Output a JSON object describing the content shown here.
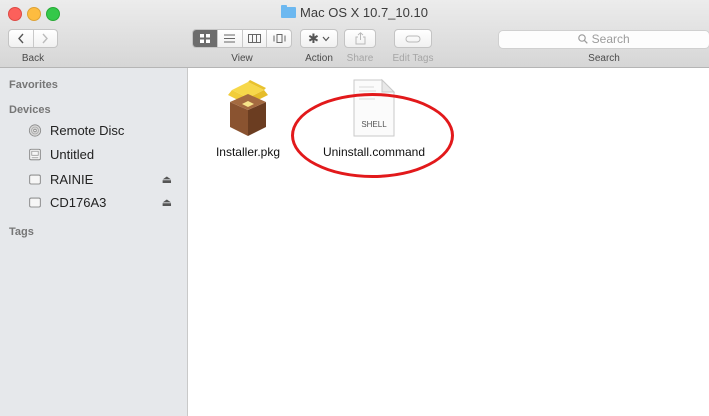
{
  "window": {
    "title": "Mac OS X 10.7_10.10"
  },
  "toolbar": {
    "back_label": "Back",
    "view_label": "View",
    "action_label": "Action",
    "share_label": "Share",
    "edit_tags_label": "Edit Tags",
    "search_placeholder": "Search",
    "search_label": "Search"
  },
  "sidebar": {
    "favorites_heading": "Favorites",
    "devices_heading": "Devices",
    "tags_heading": "Tags",
    "devices": [
      {
        "label": "Remote Disc",
        "icon": "disc-icon",
        "eject": false
      },
      {
        "label": "Untitled",
        "icon": "drive-icon",
        "eject": false
      },
      {
        "label": "RAINIE",
        "icon": "drive-icon",
        "eject": true
      },
      {
        "label": "CD176A3",
        "icon": "drive-icon",
        "eject": true
      }
    ],
    "eject_glyph": "⏏"
  },
  "files": [
    {
      "name": "Installer.pkg",
      "icon": "package-icon"
    },
    {
      "name": "Uninstall.command",
      "icon": "shell-script-icon",
      "badge": "SHELL"
    }
  ],
  "colors": {
    "annotation": "#e2191b",
    "folder": "#6cb8f0"
  }
}
